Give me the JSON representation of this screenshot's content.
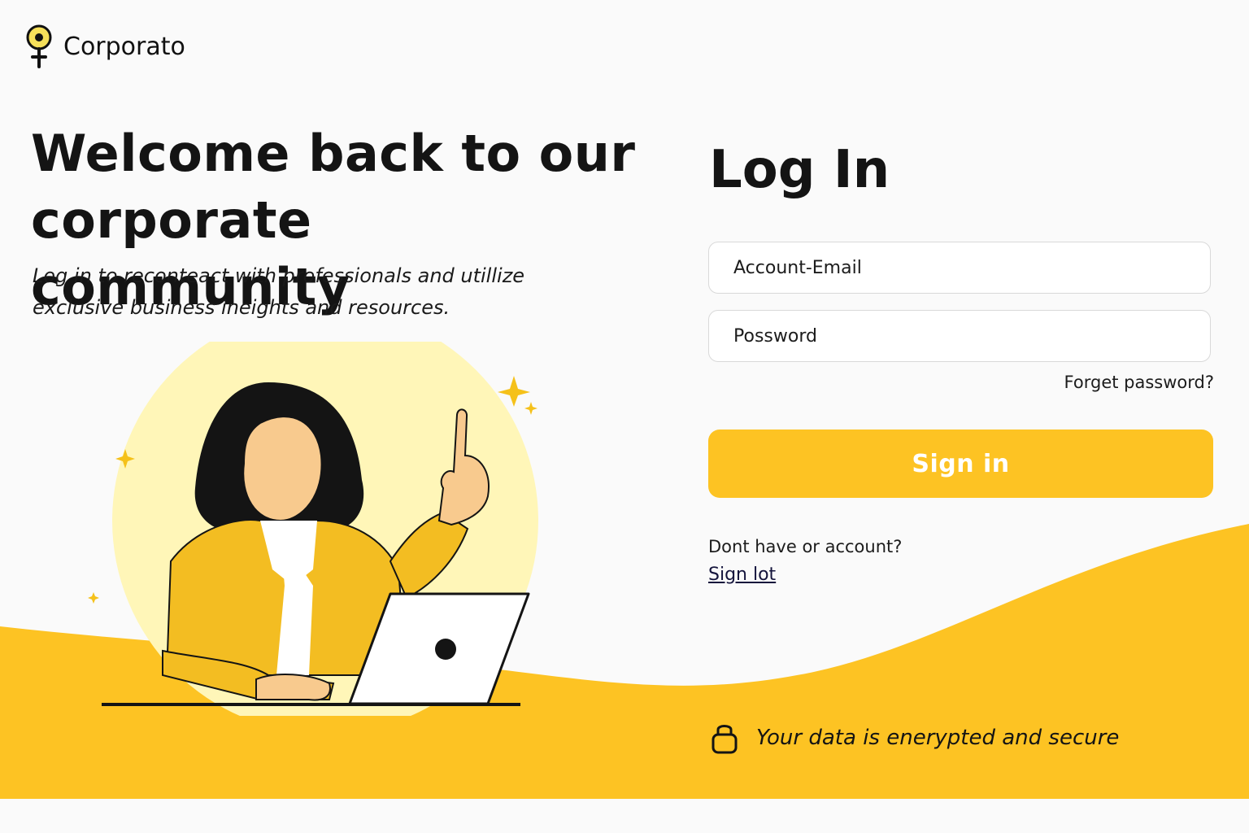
{
  "brand": {
    "name": "Corporato",
    "logo_icon": "pin-logo-icon",
    "accent": "#fdc323"
  },
  "hero": {
    "headline": "Welcome back to our corporate community",
    "subtitle": "Log in to reconteact with professionals and utillize exclusive business ineights and resources."
  },
  "login": {
    "title": "Log In",
    "email_placeholder": "Account-Email",
    "password_placeholder": "Possword",
    "forgot_label": "Forget password?",
    "signin_label": "Sign in",
    "no_account_text": "Dont have or account?",
    "signup_label": "Sign lot"
  },
  "footer": {
    "secure_text": "Your data is enerypted and secure",
    "lock_icon": "lock-icon"
  }
}
